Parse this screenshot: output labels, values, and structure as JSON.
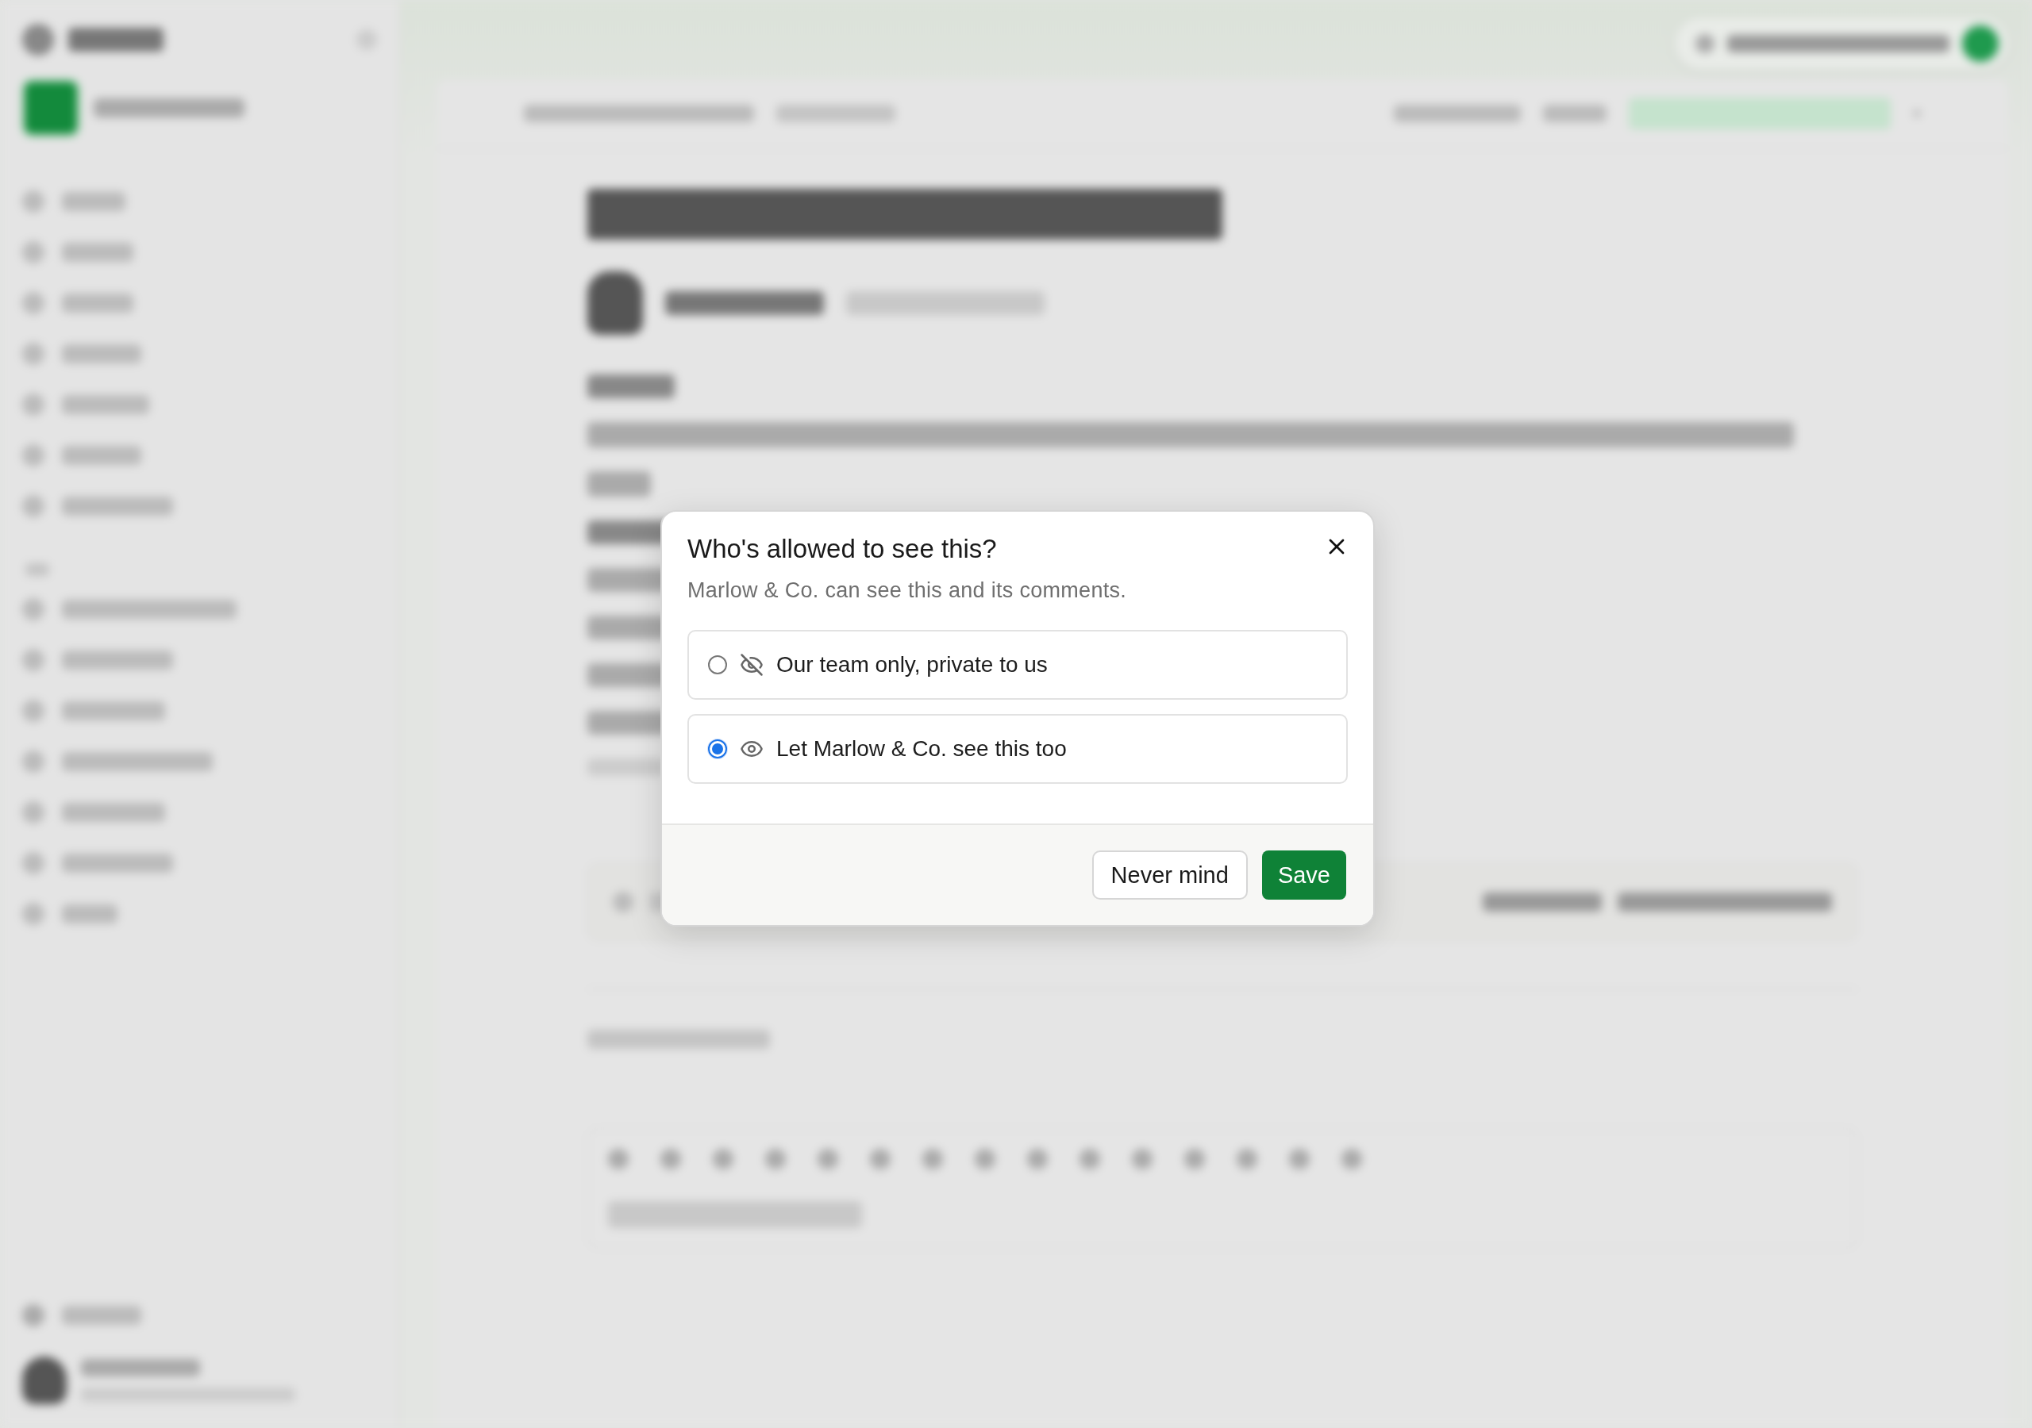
{
  "dialog": {
    "title": "Who's allowed to see this?",
    "subtitle": "Marlow & Co. can see this and its comments.",
    "options": [
      {
        "label": "Our team only, private to us",
        "kind": "hidden",
        "selected": false
      },
      {
        "label": "Let Marlow & Co. see this too",
        "kind": "visible",
        "selected": true
      }
    ],
    "cancel": "Never mind",
    "save": "Save"
  }
}
